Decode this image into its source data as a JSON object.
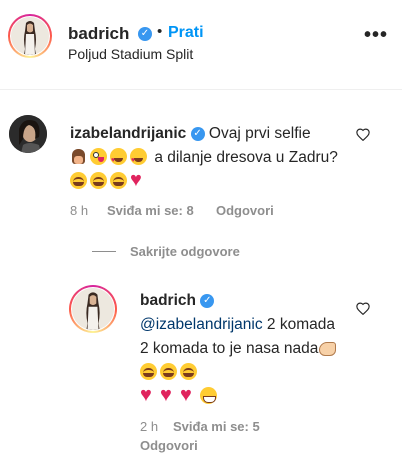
{
  "post": {
    "username": "badrich",
    "verified": true,
    "separator": "•",
    "follow_label": "Prati",
    "location": "Poljud Stadium Split",
    "more_icon": "more-options-icon"
  },
  "comment": {
    "username": "izabelandrijanic",
    "verified": true,
    "text_before": "Ovaj prvi selfie",
    "text_middle": "a dilanje dresova u Zadru?",
    "emojis_line1": [
      "raised-hands",
      "zany-face",
      "heart-eyes",
      "heart-eyes"
    ],
    "emojis_line2": [
      "joy",
      "joy",
      "joy",
      "red-heart"
    ],
    "time": "8 h",
    "likes": "Sviđa mi se: 8",
    "reply_label": "Odgovori",
    "like_icon": "heart-outline-icon"
  },
  "hide_replies_label": "Sakrijte odgovore",
  "reply": {
    "username": "badrich",
    "verified": true,
    "mention": "@izabelandrijanic",
    "text": "2 komada 2 komada to je nasa nada",
    "emojis_inline": [
      "flexed-biceps",
      "joy",
      "joy",
      "joy"
    ],
    "emojis_line": [
      "red-heart",
      "red-heart",
      "red-heart",
      "grinning"
    ],
    "time": "2 h",
    "likes": "Sviđa mi se: 5",
    "reply_label": "Odgovori",
    "like_icon": "heart-outline-icon"
  },
  "colors": {
    "link_blue": "#0095f6",
    "verified_blue": "#3897f0",
    "muted": "#8e8e8e",
    "mention": "#00376b"
  }
}
